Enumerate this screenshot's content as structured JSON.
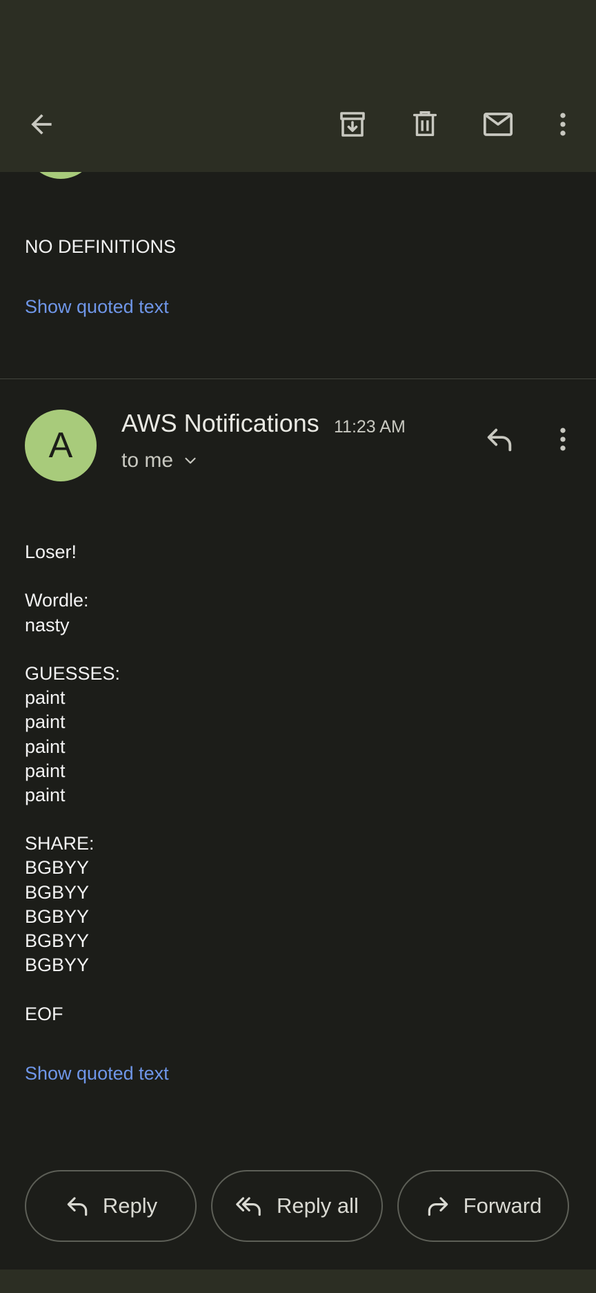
{
  "toolbar": {
    "back_icon": "arrow-left-icon",
    "archive_icon": "archive-icon",
    "delete_icon": "trash-icon",
    "mark_unread_icon": "mail-icon",
    "more_icon": "more-vert-icon"
  },
  "previous_message": {
    "body": "NO DEFINITIONS",
    "show_quoted": "Show quoted text"
  },
  "message": {
    "avatar_letter": "A",
    "sender": "AWS Notifications",
    "time": "11:23 AM",
    "recipient": "to me",
    "body_lines": [
      "Loser!",
      "",
      "Wordle:",
      "nasty",
      "",
      "GUESSES:",
      "paint",
      "paint",
      "paint",
      "paint",
      "paint",
      "",
      "SHARE:",
      "BGBYY",
      "BGBYY",
      "BGBYY",
      "BGBYY",
      "BGBYY",
      "",
      "EOF"
    ],
    "show_quoted": "Show quoted text"
  },
  "actions": {
    "reply": "Reply",
    "reply_all": "Reply all",
    "forward": "Forward"
  },
  "colors": {
    "background": "#1c1d19",
    "toolbar": "#2c2e23",
    "avatar": "#a8cb7b",
    "link": "#6f96e8"
  }
}
